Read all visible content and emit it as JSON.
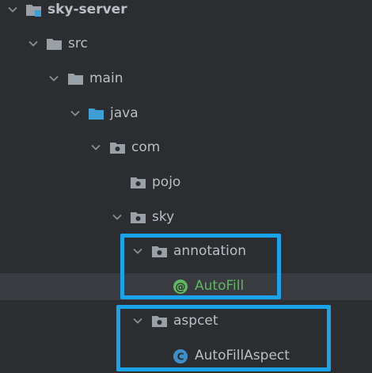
{
  "project_tree": {
    "nodes": [
      {
        "label": "sky-server",
        "icon": "module-folder-icon",
        "expanded": true
      },
      {
        "label": "src",
        "icon": "folder-icon",
        "expanded": true
      },
      {
        "label": "main",
        "icon": "folder-icon",
        "expanded": true
      },
      {
        "label": "java",
        "icon": "source-root-folder-icon",
        "expanded": true
      },
      {
        "label": "com",
        "icon": "package-icon",
        "expanded": true
      },
      {
        "label": "pojo",
        "icon": "package-icon",
        "expanded": false
      },
      {
        "label": "sky",
        "icon": "package-icon",
        "expanded": true
      },
      {
        "label": "annotation",
        "icon": "package-icon",
        "expanded": true
      },
      {
        "label": "AutoFill",
        "icon": "annotation-icon",
        "icon_glyph": "@",
        "selected": true
      },
      {
        "label": "aspcet",
        "icon": "package-icon",
        "expanded": true
      },
      {
        "label": "AutoFillAspect",
        "icon": "class-icon",
        "icon_glyph": "C"
      }
    ]
  },
  "colors": {
    "background": "#2b2d30",
    "selected_row": "#393b40",
    "text": "#bcbec4",
    "annotation_text": "#5fb761",
    "highlight_box": "#1aa3e8",
    "folder": "#9aa0a8",
    "source_folder": "#3d9fd6",
    "class_icon": "#3d8fc7",
    "annotation_icon": "#5fb761"
  }
}
